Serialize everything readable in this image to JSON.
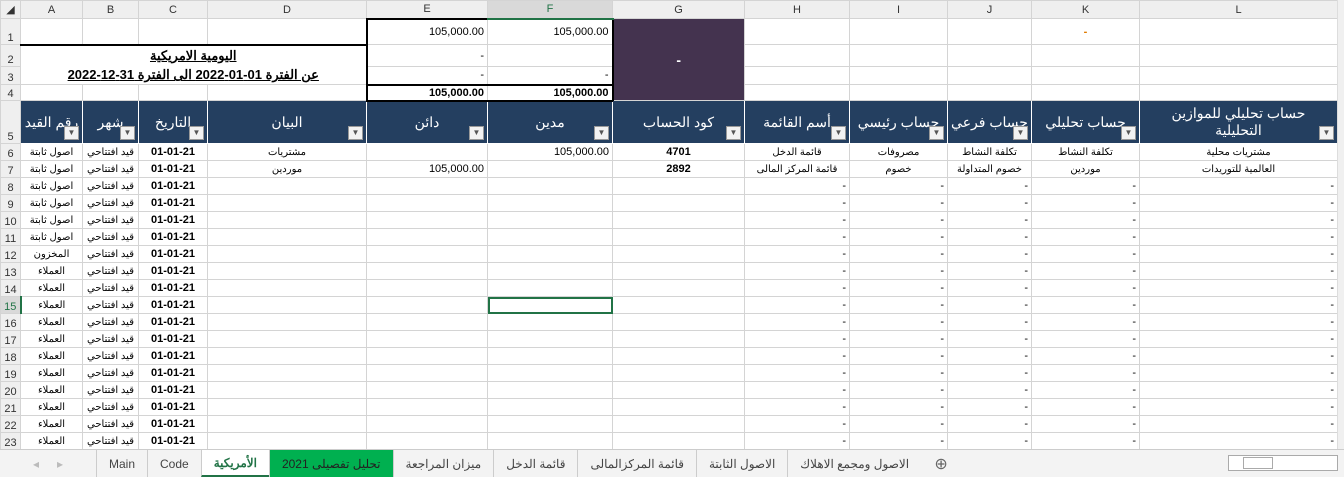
{
  "columns": [
    "A",
    "B",
    "C",
    "D",
    "E",
    "F",
    "G",
    "H",
    "I",
    "J",
    "K",
    "L"
  ],
  "summary": {
    "e1": "105,000.00",
    "f1": "105,000.00",
    "title": "اليومية الامريكية",
    "period": "عن الفترة 01-01-2022 الى الفترة 31-12-2022",
    "e2": "-",
    "e3": "-",
    "f3": "-",
    "e4": "105,000.00",
    "f4": "105,000.00",
    "g_block": "-",
    "k1": "-"
  },
  "headers": [
    "رقم القيد",
    "شهر",
    "التاريخ",
    "البيان",
    "دائن",
    "مدين",
    "كود الحساب",
    "أسم القائمة",
    "حساب رئيسي",
    "حساب فرعي",
    "حساب تحليلي",
    "حساب تحليلي للموازين التحليلية"
  ],
  "rows": [
    {
      "n": 6,
      "cells": [
        "اصول ثابتة",
        "قيد افتتاحي",
        "01-01-21",
        "مشتريات",
        "",
        "105,000.00",
        "4701",
        "قائمة الدخل",
        "مصروفات",
        "تكلفة النشاط",
        "تكلفة النشاط",
        "مشتريات محلية"
      ]
    },
    {
      "n": 7,
      "cells": [
        "اصول ثابتة",
        "قيد افتتاحي",
        "01-01-21",
        "موردين",
        "105,000.00",
        "",
        "2892",
        "قائمة المركز المالى",
        "خصوم",
        "خصوم المتداولة",
        "موردين",
        "العالمية للتوريدات"
      ]
    },
    {
      "n": 8,
      "cells": [
        "اصول ثابتة",
        "قيد افتتاحي",
        "01-01-21",
        "",
        "",
        "",
        "",
        "-",
        "-",
        "-",
        "-",
        "-"
      ]
    },
    {
      "n": 9,
      "cells": [
        "اصول ثابتة",
        "قيد افتتاحي",
        "01-01-21",
        "",
        "",
        "",
        "",
        "-",
        "-",
        "-",
        "-",
        "-"
      ]
    },
    {
      "n": 10,
      "cells": [
        "اصول ثابتة",
        "قيد افتتاحي",
        "01-01-21",
        "",
        "",
        "",
        "",
        "-",
        "-",
        "-",
        "-",
        "-"
      ]
    },
    {
      "n": 11,
      "cells": [
        "اصول ثابتة",
        "قيد افتتاحي",
        "01-01-21",
        "",
        "",
        "",
        "",
        "-",
        "-",
        "-",
        "-",
        "-"
      ]
    },
    {
      "n": 12,
      "cells": [
        "المخزون",
        "قيد افتتاحي",
        "01-01-21",
        "",
        "",
        "",
        "",
        "-",
        "-",
        "-",
        "-",
        "-"
      ]
    },
    {
      "n": 13,
      "cells": [
        "العملاء",
        "قيد افتتاحي",
        "01-01-21",
        "",
        "",
        "",
        "",
        "-",
        "-",
        "-",
        "-",
        "-"
      ]
    },
    {
      "n": 14,
      "cells": [
        "العملاء",
        "قيد افتتاحي",
        "01-01-21",
        "",
        "",
        "",
        "",
        "-",
        "-",
        "-",
        "-",
        "-"
      ]
    },
    {
      "n": 15,
      "cells": [
        "العملاء",
        "قيد افتتاحي",
        "01-01-21",
        "",
        "",
        "",
        "",
        "-",
        "-",
        "-",
        "-",
        "-"
      ]
    },
    {
      "n": 16,
      "cells": [
        "العملاء",
        "قيد افتتاحي",
        "01-01-21",
        "",
        "",
        "",
        "",
        "-",
        "-",
        "-",
        "-",
        "-"
      ]
    },
    {
      "n": 17,
      "cells": [
        "العملاء",
        "قيد افتتاحي",
        "01-01-21",
        "",
        "",
        "",
        "",
        "-",
        "-",
        "-",
        "-",
        "-"
      ]
    },
    {
      "n": 18,
      "cells": [
        "العملاء",
        "قيد افتتاحي",
        "01-01-21",
        "",
        "",
        "",
        "",
        "-",
        "-",
        "-",
        "-",
        "-"
      ]
    },
    {
      "n": 19,
      "cells": [
        "العملاء",
        "قيد افتتاحي",
        "01-01-21",
        "",
        "",
        "",
        "",
        "-",
        "-",
        "-",
        "-",
        "-"
      ]
    },
    {
      "n": 20,
      "cells": [
        "العملاء",
        "قيد افتتاحي",
        "01-01-21",
        "",
        "",
        "",
        "",
        "-",
        "-",
        "-",
        "-",
        "-"
      ]
    },
    {
      "n": 21,
      "cells": [
        "العملاء",
        "قيد افتتاحي",
        "01-01-21",
        "",
        "",
        "",
        "",
        "-",
        "-",
        "-",
        "-",
        "-"
      ]
    },
    {
      "n": 22,
      "cells": [
        "العملاء",
        "قيد افتتاحي",
        "01-01-21",
        "",
        "",
        "",
        "",
        "-",
        "-",
        "-",
        "-",
        "-"
      ]
    },
    {
      "n": 23,
      "cells": [
        "العملاء",
        "قيد افتتاحي",
        "01-01-21",
        "",
        "",
        "",
        "",
        "-",
        "-",
        "-",
        "-",
        "-"
      ]
    }
  ],
  "selected": {
    "row": 15,
    "col": "F"
  },
  "tabs": [
    {
      "label": "Main"
    },
    {
      "label": "Code"
    },
    {
      "label": "الأمريكية",
      "active": true
    },
    {
      "label": "تحليل تفصيلى 2021",
      "green": true
    },
    {
      "label": "ميزان المراجعة"
    },
    {
      "label": "قائمة الدخل"
    },
    {
      "label": "قائمة المركزالمالى"
    },
    {
      "label": "الاصول الثابتة"
    },
    {
      "label": "الاصول ومجمع الاهلاك"
    }
  ],
  "colors": {
    "header_bg": "#243f60",
    "purple": "#44334f",
    "excel_green": "#217346",
    "tab_green": "#00b050",
    "orange": "#e07b00"
  }
}
